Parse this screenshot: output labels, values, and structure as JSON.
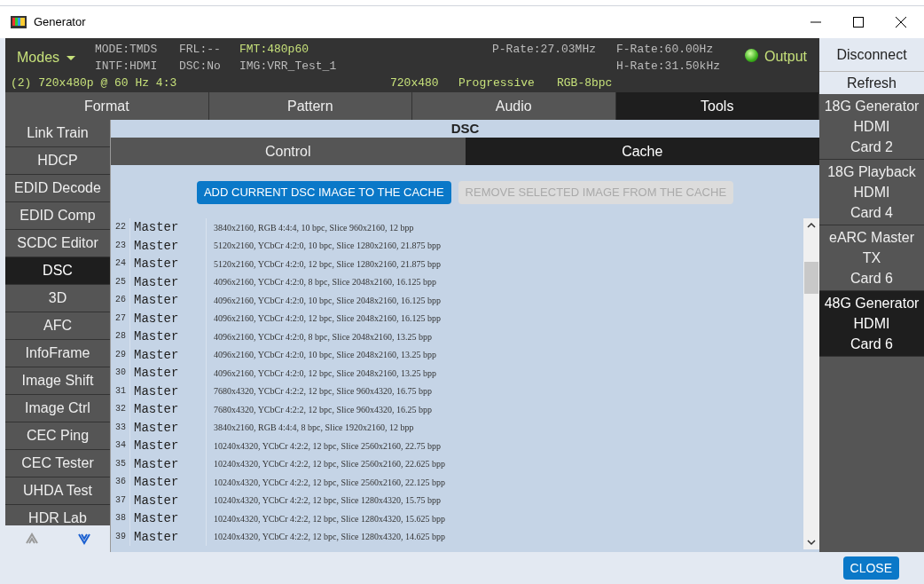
{
  "window": {
    "title": "Generator"
  },
  "header": {
    "modes": "Modes",
    "mode": "MODE:TMDS",
    "frl": "FRL:--",
    "fmt": "FMT:480p60",
    "intf": "INTF:HDMI",
    "dsc": "DSC:No",
    "img": "IMG:VRR_Test_1",
    "p_rate": "P-Rate:27.03MHz",
    "f_rate": "F-Rate:60.00Hz",
    "h_rate": "H-Rate:31.50kHz",
    "output": {
      "label": "Output",
      "on": true
    },
    "timing": "(2) 720x480p @ 60 Hz 4:3",
    "resolution": "720x480",
    "scan": "Progressive",
    "color_format": "RGB-8bpc"
  },
  "actions": [
    "Disconnect",
    "Refresh"
  ],
  "tabs": [
    {
      "label": "Format",
      "selected": false
    },
    {
      "label": "Pattern",
      "selected": false
    },
    {
      "label": "Audio",
      "selected": false
    },
    {
      "label": "Tools",
      "selected": true
    }
  ],
  "sidebar": {
    "items": [
      {
        "label": "Link Train",
        "selected": false
      },
      {
        "label": "HDCP",
        "selected": false
      },
      {
        "label": "EDID Decode",
        "selected": false
      },
      {
        "label": "EDID Comp",
        "selected": false
      },
      {
        "label": "SCDC Editor",
        "selected": false
      },
      {
        "label": "DSC",
        "selected": true
      },
      {
        "label": "3D",
        "selected": false
      },
      {
        "label": "AFC",
        "selected": false
      },
      {
        "label": "InfoFrame",
        "selected": false
      },
      {
        "label": "Image Shift",
        "selected": false
      },
      {
        "label": "Image Ctrl",
        "selected": false
      },
      {
        "label": "CEC Ping",
        "selected": false
      },
      {
        "label": "CEC Tester",
        "selected": false
      },
      {
        "label": "UHDA Test",
        "selected": false
      },
      {
        "label": "HDR Lab",
        "selected": false
      }
    ]
  },
  "panel": {
    "title": "DSC",
    "subtabs": [
      {
        "label": "Control",
        "selected": false
      },
      {
        "label": "Cache",
        "selected": true
      }
    ],
    "buttons": [
      {
        "label": "ADD CURRENT DSC IMAGE TO THE CACHE",
        "disabled": false
      },
      {
        "label": "REMOVE SELECTED IMAGE FROM THE CACHE",
        "disabled": true
      }
    ],
    "rows": [
      {
        "index": "22",
        "name": "Master",
        "description": "3840x2160, RGB 4:4:4, 10 bpc, Slice 960x2160, 12 bpp"
      },
      {
        "index": "23",
        "name": "Master",
        "description": "5120x2160, YCbCr 4:2:0, 10 bpc, Slice 1280x2160, 21.875 bpp"
      },
      {
        "index": "24",
        "name": "Master",
        "description": "5120x2160, YCbCr 4:2:0, 12 bpc, Slice 1280x2160, 21.875 bpp"
      },
      {
        "index": "25",
        "name": "Master",
        "description": "4096x2160, YCbCr 4:2:0, 8 bpc, Slice 2048x2160, 16.125 bpp"
      },
      {
        "index": "26",
        "name": "Master",
        "description": "4096x2160, YCbCr 4:2:0, 10 bpc, Slice 2048x2160, 16.125 bpp"
      },
      {
        "index": "27",
        "name": "Master",
        "description": "4096x2160, YCbCr 4:2:0, 12 bpc, Slice 2048x2160, 16.125 bpp"
      },
      {
        "index": "28",
        "name": "Master",
        "description": "4096x2160, YCbCr 4:2:0, 8 bpc, Slice 2048x2160, 13.25 bpp"
      },
      {
        "index": "29",
        "name": "Master",
        "description": "4096x2160, YCbCr 4:2:0, 10 bpc, Slice 2048x2160, 13.25 bpp"
      },
      {
        "index": "30",
        "name": "Master",
        "description": "4096x2160, YCbCr 4:2:0, 12 bpc, Slice 2048x2160, 13.25 bpp"
      },
      {
        "index": "31",
        "name": "Master",
        "description": "7680x4320, YCbCr 4:2:2, 12 bpc, Slice 960x4320, 16.75 bpp"
      },
      {
        "index": "32",
        "name": "Master",
        "description": "7680x4320, YCbCr 4:2:2, 12 bpc, Slice 960x4320, 16.25 bpp"
      },
      {
        "index": "33",
        "name": "Master",
        "description": "3840x2160, RGB 4:4:4, 8 bpc, Slice 1920x2160, 12 bpp"
      },
      {
        "index": "34",
        "name": "Master",
        "description": "10240x4320, YCbCr 4:2:2, 12 bpc, Slice 2560x2160, 22.75 bpp"
      },
      {
        "index": "35",
        "name": "Master",
        "description": "10240x4320, YCbCr 4:2:2, 12 bpc, Slice 2560x2160, 22.625 bpp"
      },
      {
        "index": "36",
        "name": "Master",
        "description": "10240x4320, YCbCr 4:2:2, 12 bpc, Slice 2560x2160, 22.125 bpp"
      },
      {
        "index": "37",
        "name": "Master",
        "description": "10240x4320, YCbCr 4:2:2, 12 bpc, Slice 1280x4320, 15.75 bpp"
      },
      {
        "index": "38",
        "name": "Master",
        "description": "10240x4320, YCbCr 4:2:2, 12 bpc, Slice 1280x4320, 15.625 bpp"
      },
      {
        "index": "39",
        "name": "Master",
        "description": "10240x4320, YCbCr 4:2:2, 12 bpc, Slice 1280x4320, 14.625 bpp"
      }
    ]
  },
  "cards": [
    {
      "lines": [
        "18G Generator",
        "HDMI",
        "Card 2"
      ],
      "selected": false
    },
    {
      "lines": [
        "18G Playback",
        "HDMI",
        "Card 4"
      ],
      "selected": false
    },
    {
      "lines": [
        "eARC Master",
        "TX",
        "Card 6"
      ],
      "selected": false
    },
    {
      "lines": [
        "48G Generator",
        "HDMI",
        "Card 6"
      ],
      "selected": true
    }
  ],
  "footer": {
    "close": "CLOSE"
  }
}
